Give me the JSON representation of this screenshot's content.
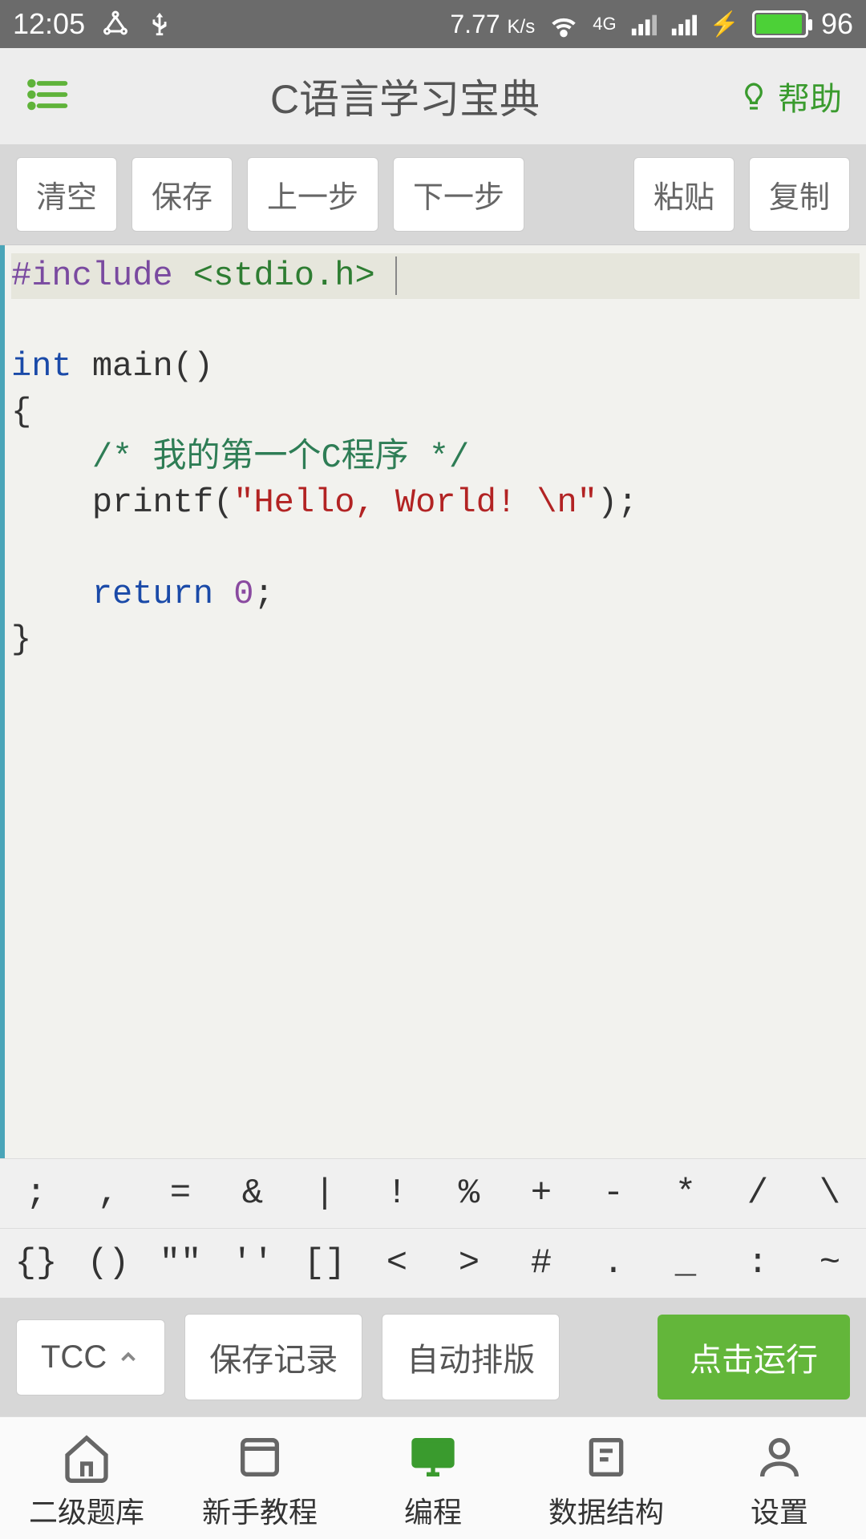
{
  "status": {
    "time": "12:05",
    "speed": "7.77",
    "speed_unit": "K/s",
    "network_label": "4G",
    "battery": "96"
  },
  "header": {
    "title": "C语言学习宝典",
    "help_label": "帮助"
  },
  "toolbar": {
    "clear": "清空",
    "save": "保存",
    "prev": "上一步",
    "next": "下一步",
    "paste": "粘贴",
    "copy": "复制"
  },
  "code": {
    "line1_include": "#include",
    "line1_header": "<stdio.h>",
    "line3_kw": "int",
    "line3_fn": " main()",
    "line4": "{",
    "line5_cmt": "/* 我的第一个C程序 */",
    "line6_pre": "printf(",
    "line6_str": "\"Hello, World! \\n\"",
    "line6_post": ");",
    "line8_kw": "return",
    "line8_num": " 0",
    "line8_post": ";",
    "line9": "}"
  },
  "symbols": {
    "row1": [
      ";",
      ",",
      "=",
      "&",
      "|",
      "!",
      "%",
      "+",
      "-",
      "*",
      "/",
      "\\"
    ],
    "row2": [
      "{}",
      "()",
      "\"\"",
      "''",
      "[]",
      "<",
      ">",
      "#",
      ".",
      "_",
      ":",
      "~"
    ]
  },
  "actions": {
    "compiler": "TCC",
    "save_record": "保存记录",
    "auto_format": "自动排版",
    "run": "点击运行"
  },
  "nav": {
    "items": [
      {
        "label": "二级题库"
      },
      {
        "label": "新手教程"
      },
      {
        "label": "编程"
      },
      {
        "label": "数据结构"
      },
      {
        "label": "设置"
      }
    ]
  }
}
